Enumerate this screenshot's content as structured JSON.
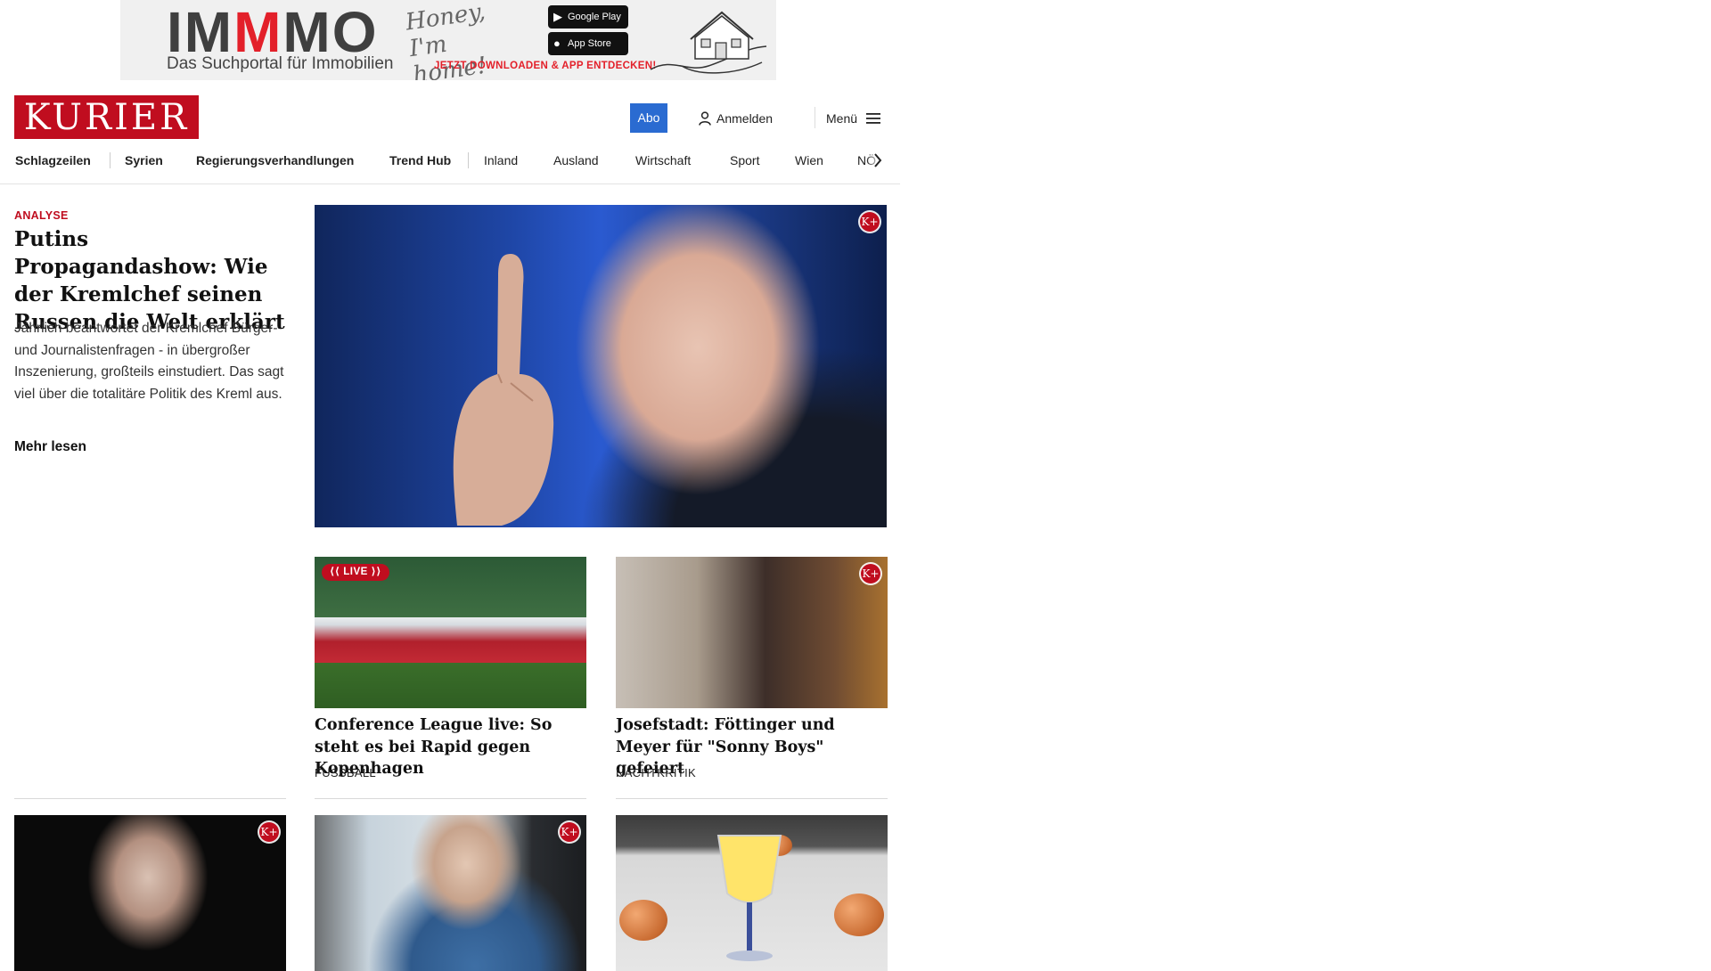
{
  "ad": {
    "brand_prefix": "IM",
    "brand_highlight": "M",
    "brand_suffix": "MO",
    "slogan": "Das Suchportal für Immobilien",
    "handwriting": "Honey, I'm home!",
    "google_play": "Google Play",
    "app_store": "App Store",
    "cta": "JETZT DOWNLOADEN & APP ENTDECKEN!"
  },
  "header": {
    "logo": "KURIER",
    "abo": "Abo",
    "login": "Anmelden",
    "menu": "Menü"
  },
  "nav": {
    "items": [
      {
        "label": "Schlagzeilen"
      },
      {
        "label": "Syrien"
      },
      {
        "label": "Regierungsverhandlungen"
      },
      {
        "label": "Trend Hub"
      },
      {
        "label": "Inland"
      },
      {
        "label": "Ausland"
      },
      {
        "label": "Wirtschaft"
      },
      {
        "label": "Sport"
      },
      {
        "label": "Wien"
      },
      {
        "label": "NÖ"
      }
    ]
  },
  "lead": {
    "kicker": "ANALYSE",
    "title": "Putins Propagandashow: Wie der Kremlchef seinen Russen die Welt erklärt",
    "teaser": "Jährlich beantwortet der Kremlchef Bürger- und Journalistenfragen - in übergroßer Inszenierung, großteils einstudiert. Das sagt viel über die totalitäre Politik des Kreml aus.",
    "more": "Mehr lesen",
    "badge": "K+"
  },
  "cards": [
    {
      "title": "Conference League live: So steht es bei Rapid gegen Kopenhagen",
      "category": "FUSSBALL",
      "badge": "LIVE"
    },
    {
      "title": "Josefstadt: Föttinger und Meyer für \"Sonny Boys\" gefeiert",
      "category": "NACHTKRITIK",
      "badge": "K+"
    }
  ],
  "row3": [
    {
      "badge": "K+"
    },
    {
      "badge": "K+"
    },
    {
      "badge": ""
    }
  ],
  "colors": {
    "brand_red": "#c00d1f",
    "abo_blue": "#2a6bd1"
  }
}
